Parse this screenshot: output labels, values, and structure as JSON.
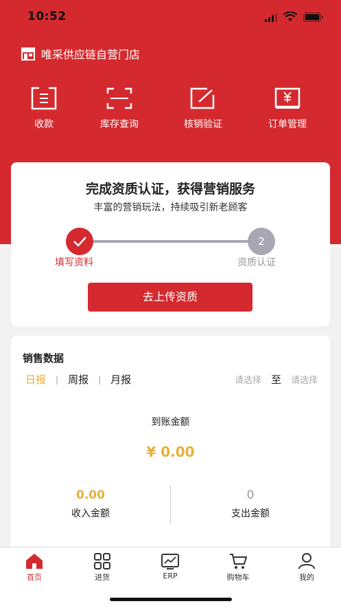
{
  "status_bar": {
    "time": "10:52"
  },
  "store": {
    "name": "唯采供应链自营门店"
  },
  "quick_actions": [
    {
      "label": "收款",
      "icon": "receipt-icon"
    },
    {
      "label": "库存查询",
      "icon": "scan-icon"
    },
    {
      "label": "核销验证",
      "icon": "edit-icon"
    },
    {
      "label": "订单管理",
      "icon": "yen-icon"
    }
  ],
  "certification": {
    "title": "完成资质认证，获得营销服务",
    "subtitle": "丰富的营销玩法，持续吸引新老顾客",
    "step1_label": "填写资料",
    "step2_number": "2",
    "step2_label": "资质认证",
    "upload_button": "去上传资质"
  },
  "sales": {
    "title": "销售数据",
    "tabs": [
      "日报",
      "周报",
      "月报"
    ],
    "active_tab": "日报",
    "range_start_placeholder": "请选择",
    "range_to": "至",
    "range_end_placeholder": "请选择",
    "received_label": "到账金额",
    "received_value": "¥ 0.00",
    "income_value": "0.00",
    "income_label": "收入金额",
    "expense_value": "0",
    "expense_label": "支出金额"
  },
  "tabbar": [
    {
      "label": "首页",
      "icon": "home-icon",
      "active": true
    },
    {
      "label": "进货",
      "icon": "grid-icon",
      "active": false
    },
    {
      "label": "ERP",
      "icon": "chart-icon",
      "active": false
    },
    {
      "label": "购物车",
      "icon": "cart-icon",
      "active": false
    },
    {
      "label": "我的",
      "icon": "user-icon",
      "active": false
    }
  ],
  "colors": {
    "brand": "#d42a2f",
    "accent": "#e6b03b",
    "inactive": "#a9a7b3"
  }
}
